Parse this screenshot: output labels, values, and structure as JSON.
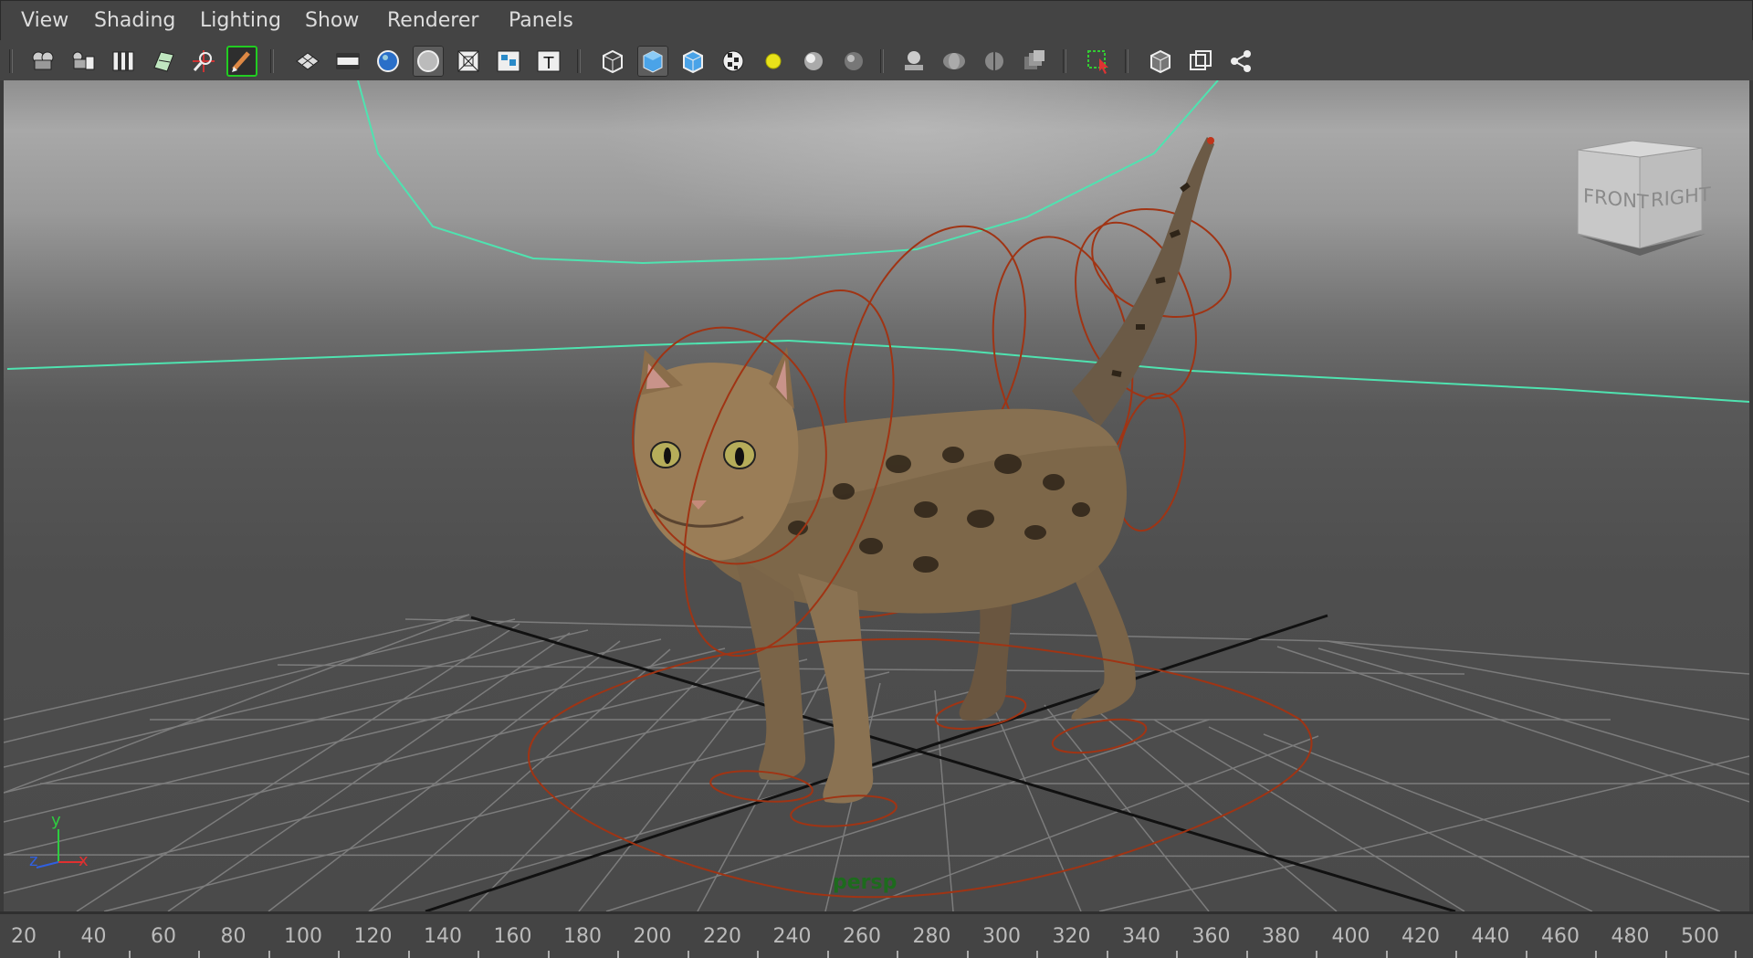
{
  "menu": {
    "items": [
      "View",
      "Shading",
      "Lighting",
      "Show",
      "Renderer",
      "Panels"
    ]
  },
  "toolbar": {
    "groups": [
      [
        "select-camera-icon",
        "camera-attributes-icon",
        "bookmarks-icon",
        "image-plane-icon",
        "grid-2d-pan-zoom-icon",
        "grease-pencil-icon"
      ],
      [
        "grid-icon",
        "film-gate-icon",
        "resolution-gate-icon",
        "gate-mask-icon",
        "field-chart-icon",
        "safe-action-icon",
        "safe-title-icon"
      ],
      [
        "wireframe-icon",
        "smooth-shade-icon",
        "wireframe-on-shaded-icon",
        "textured-icon",
        "use-all-lights-icon",
        "use-default-light-icon",
        "shadows-icon"
      ],
      [
        "screen-space-ao-icon",
        "motion-blur-icon",
        "multisample-aa-icon",
        "depth-of-field-icon"
      ],
      [
        "isolate-select-icon"
      ],
      [
        "xray-icon",
        "xray-active-components-icon",
        "xray-joints-icon"
      ]
    ],
    "active": [
      "gate-mask-icon",
      "smooth-shade-icon"
    ]
  },
  "viewport": {
    "camera_label": "persp",
    "viewcube": {
      "front": "FRONT",
      "right": "RIGHT"
    },
    "axis": {
      "y": "y",
      "z": "z",
      "x": "x"
    },
    "colors": {
      "camera_curve": "#4fe3b0",
      "control_curves": "#a03414",
      "grid": "#7e7e7e",
      "axis_lines": "#111111"
    }
  },
  "timeline": {
    "ticks": [
      20,
      40,
      60,
      80,
      100,
      120,
      140,
      160,
      180,
      200,
      220,
      240,
      260,
      280,
      300,
      320,
      340,
      360,
      380,
      400,
      420,
      440,
      460,
      480,
      500
    ]
  }
}
